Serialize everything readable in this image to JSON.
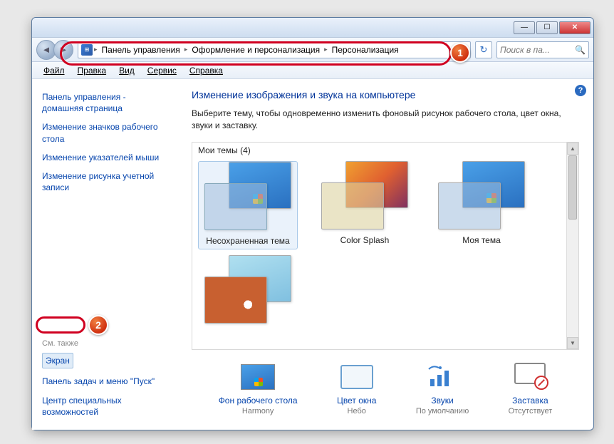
{
  "breadcrumb": {
    "root_sep": "▸",
    "a": "Панель управления",
    "b": "Оформление и персонализация",
    "c": "Персонализация"
  },
  "search": {
    "placeholder": "Поиск в па..."
  },
  "menu": {
    "file": "Файл",
    "edit": "Правка",
    "view": "Вид",
    "tools": "Сервис",
    "help": "Справка"
  },
  "sidebar": {
    "home": "Панель управления - домашняя страница",
    "icons": "Изменение значков рабочего стола",
    "pointers": "Изменение указателей мыши",
    "account_pic": "Изменение рисунка учетной записи",
    "see_also": "См. также",
    "screen": "Экран",
    "taskbar": "Панель задач и меню \"Пуск\"",
    "ease": "Центр специальных возможностей"
  },
  "main": {
    "title": "Изменение изображения и звука на компьютере",
    "desc": "Выберите тему, чтобы одновременно изменить фоновый рисунок рабочего стола, цвет окна, звуки и заставку.",
    "themes_header": "Мои темы (4)",
    "themes": {
      "unsaved": "Несохраненная тема",
      "color": "Color Splash",
      "my": "Моя тема"
    }
  },
  "bottom": {
    "desktop": {
      "label": "Фон рабочего стола",
      "value": "Harmony"
    },
    "window_color": {
      "label": "Цвет окна",
      "value": "Небо"
    },
    "sounds": {
      "label": "Звуки",
      "value": "По умолчанию"
    },
    "saver": {
      "label": "Заставка",
      "value": "Отсутствует"
    }
  },
  "callouts": {
    "one": "1",
    "two": "2"
  }
}
